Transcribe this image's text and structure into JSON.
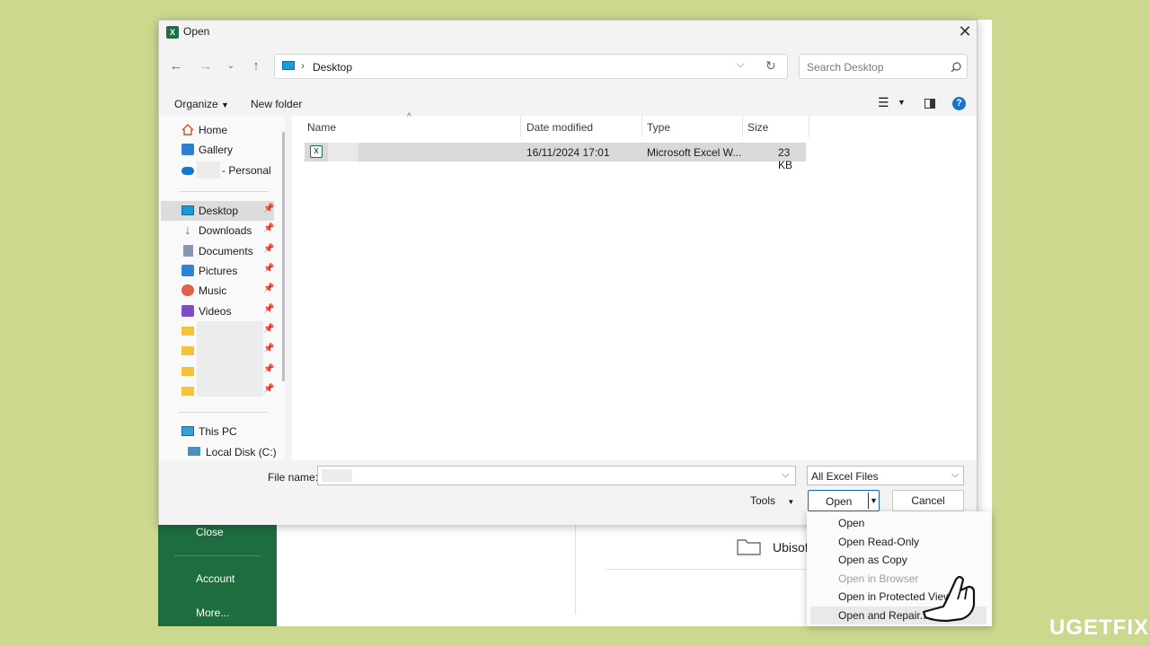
{
  "excel": {
    "side_items": [
      "Close",
      "Account",
      "More..."
    ],
    "folder_label": "Ubisoft"
  },
  "dialog": {
    "title": "Open",
    "close_glyph": "✕",
    "address": {
      "path": "Desktop"
    },
    "search": {
      "placeholder": "Search Desktop"
    },
    "toolbar": {
      "organize": "Organize",
      "new_folder": "New folder"
    },
    "nav": {
      "quick": [
        {
          "label": "Home",
          "icon": "home-icon"
        },
        {
          "label": "Gallery",
          "icon": "gallery-icon"
        },
        {
          "label": "- Personal",
          "icon": "onedrive-icon"
        }
      ],
      "pinned": [
        {
          "label": "Desktop",
          "icon": "desktop-icon"
        },
        {
          "label": "Downloads",
          "icon": "downloads-icon"
        },
        {
          "label": "Documents",
          "icon": "documents-icon"
        },
        {
          "label": "Pictures",
          "icon": "pictures-icon"
        },
        {
          "label": "Music",
          "icon": "music-icon"
        },
        {
          "label": "Videos",
          "icon": "videos-icon"
        }
      ],
      "this_pc": "This PC",
      "local_disk": "Local Disk (C:)"
    },
    "columns": {
      "name": "Name",
      "date_modified": "Date modified",
      "type": "Type",
      "size": "Size"
    },
    "files": [
      {
        "name": "",
        "date_modified": "16/11/2024 17:01",
        "type": "Microsoft Excel W...",
        "size": "23 KB"
      }
    ],
    "file_name_label": "File name:",
    "file_name_value": "",
    "filter": "All Excel Files",
    "tools": "Tools",
    "open_button": "Open",
    "cancel_button": "Cancel"
  },
  "open_menu": {
    "items": [
      "Open",
      "Open Read-Only",
      "Open as Copy",
      "Open in Browser",
      "Open in Protected View",
      "Open and Repair..."
    ],
    "disabled": [
      "Open in Browser"
    ],
    "highlighted": "Open and Repair..."
  },
  "watermark": "UGETFIX",
  "colors": {
    "background": "#cdd88f",
    "excel_green": "#1e6d3f",
    "accent": "#0f6cbd"
  }
}
